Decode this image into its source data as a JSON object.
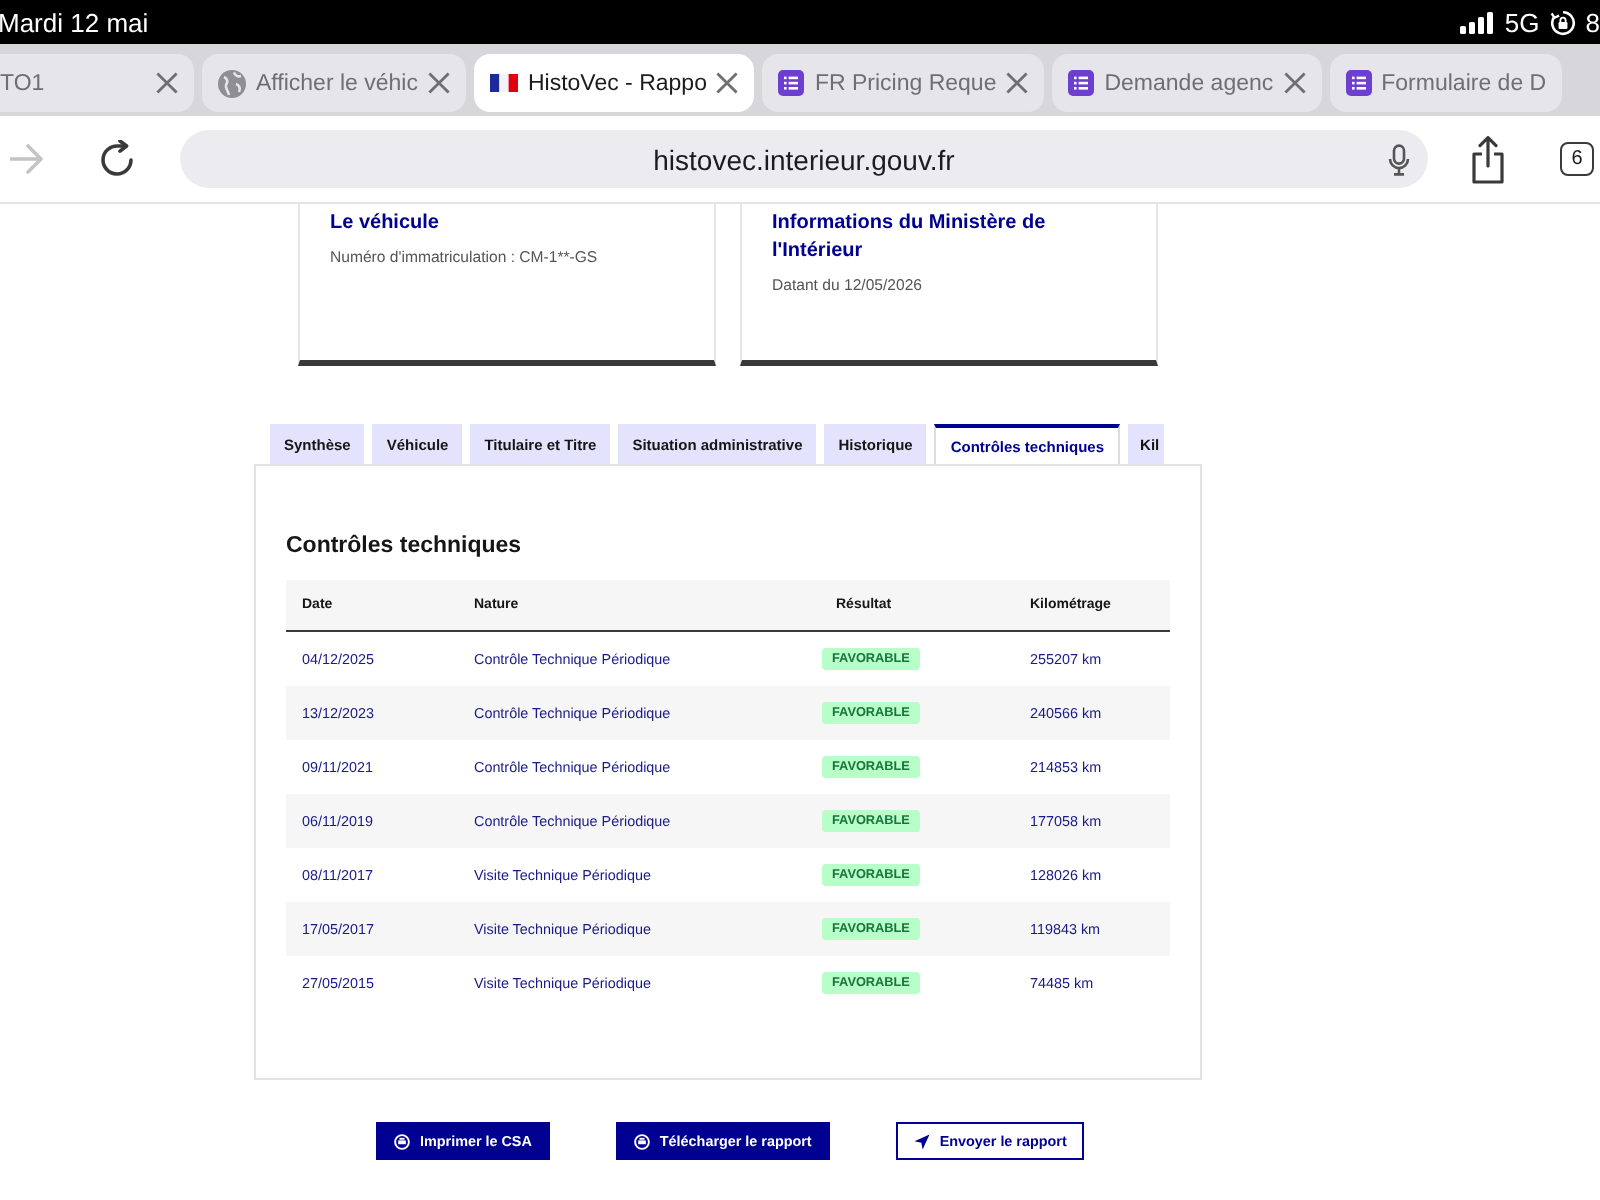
{
  "status_bar": {
    "date": "Mardi 12 mai",
    "network": "5G",
    "battery": "8"
  },
  "browser_tabs": [
    {
      "title": "TO1",
      "kind": "plain",
      "selected": false,
      "closable": true
    },
    {
      "title": "Afficher le véhic",
      "kind": "globe",
      "selected": false,
      "closable": true
    },
    {
      "title": "HistoVec - Rappo",
      "kind": "flag",
      "selected": true,
      "closable": true
    },
    {
      "title": "FR Pricing Reque",
      "kind": "form",
      "selected": false,
      "closable": true
    },
    {
      "title": "Demande agenc",
      "kind": "form",
      "selected": false,
      "closable": true
    },
    {
      "title": "Formulaire de D",
      "kind": "form",
      "selected": false,
      "closable": false
    }
  ],
  "toolbar": {
    "url": "histovec.interieur.gouv.fr",
    "tab_count": "6"
  },
  "cards": [
    {
      "title": "Le véhicule",
      "text": "Numéro d'immatriculation : CM-1**-GS"
    },
    {
      "title": "Informations du Ministère de l'Intérieur",
      "text": "Datant du 12/05/2026"
    }
  ],
  "report_tabs": [
    {
      "label": "Synthèse",
      "selected": false
    },
    {
      "label": "Véhicule",
      "selected": false
    },
    {
      "label": "Titulaire et Titre",
      "selected": false
    },
    {
      "label": "Situation administrative",
      "selected": false
    },
    {
      "label": "Historique",
      "selected": false
    },
    {
      "label": "Contrôles techniques",
      "selected": true
    },
    {
      "label": "Kil",
      "selected": false
    }
  ],
  "technical_inspections": {
    "title": "Contrôles techniques",
    "columns": [
      "Date",
      "Nature",
      "Résultat",
      "Kilométrage"
    ],
    "rows": [
      {
        "date": "04/12/2025",
        "nature": "Contrôle Technique Périodique",
        "result": "FAVORABLE",
        "mileage": "255207 km"
      },
      {
        "date": "13/12/2023",
        "nature": "Contrôle Technique Périodique",
        "result": "FAVORABLE",
        "mileage": "240566 km"
      },
      {
        "date": "09/11/2021",
        "nature": "Contrôle Technique Périodique",
        "result": "FAVORABLE",
        "mileage": "214853 km"
      },
      {
        "date": "06/11/2019",
        "nature": "Contrôle Technique Périodique",
        "result": "FAVORABLE",
        "mileage": "177058 km"
      },
      {
        "date": "08/11/2017",
        "nature": "Visite Technique Périodique",
        "result": "FAVORABLE",
        "mileage": "128026 km"
      },
      {
        "date": "17/05/2017",
        "nature": "Visite Technique Périodique",
        "result": "FAVORABLE",
        "mileage": "119843 km"
      },
      {
        "date": "27/05/2015",
        "nature": "Visite Technique Périodique",
        "result": "FAVORABLE",
        "mileage": "74485 km"
      }
    ]
  },
  "actions": [
    {
      "label": "Imprimer le CSA",
      "kind": "print"
    },
    {
      "label": "Télécharger le rapport",
      "kind": "print"
    },
    {
      "label": "Envoyer le rapport",
      "kind": "send"
    }
  ]
}
